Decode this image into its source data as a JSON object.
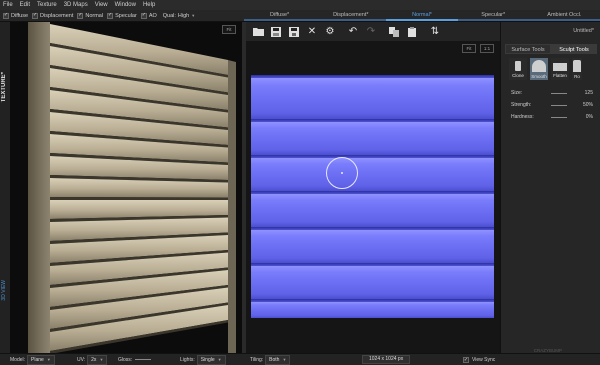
{
  "menu": [
    "File",
    "Edit",
    "Texture",
    "3D Maps",
    "View",
    "Window",
    "Help"
  ],
  "options_bar": {
    "checks": [
      {
        "label": "Diffuse",
        "checked": true
      },
      {
        "label": "Displacement",
        "checked": true
      },
      {
        "label": "Normal",
        "checked": true
      },
      {
        "label": "Specular",
        "checked": true
      },
      {
        "label": "AO",
        "checked": true
      }
    ],
    "quality_label": "Qual:",
    "quality_value": "High"
  },
  "tabs": [
    "Diffuse*",
    "Displacement*",
    "Normal*",
    "Specular*",
    "Ambient Occl."
  ],
  "active_tab": 2,
  "left_strip": {
    "title": "TEXTURE*",
    "link": "3D VIEW"
  },
  "viewport3d": {
    "fit_label": "Fit"
  },
  "toolbar2": {
    "icons": [
      "folder-open-icon",
      "save-icon",
      "save-as-icon",
      "close-icon",
      "gear-icon",
      "undo-icon",
      "redo-icon",
      "copy-icon",
      "paste-icon",
      "swap-icon"
    ]
  },
  "canvas2d": {
    "fit_label": "Fit",
    "ratio_label": "1:1"
  },
  "right_panel": {
    "title": "Untitled*",
    "tabs": [
      "Surface Tools",
      "Sculpt Tools"
    ],
    "active_tab": 1,
    "tools": [
      {
        "label": "Clone",
        "active": false
      },
      {
        "label": "Smooth",
        "active": true
      },
      {
        "label": "Flatten",
        "active": false
      },
      {
        "label": "Ro",
        "active": false
      }
    ],
    "params": [
      {
        "label": "Size:",
        "value": "125"
      },
      {
        "label": "Strength:",
        "value": "50%"
      },
      {
        "label": "Hardness:",
        "value": "0%"
      }
    ]
  },
  "status": {
    "model_label": "Model:",
    "model_value": "Plane",
    "uv_label": "UV:",
    "uv_value": "2x",
    "gloss_label": "Gloss:",
    "lights_label": "Lights:",
    "lights_value": "Single",
    "tiling_label": "Tiling:",
    "tiling_value": "Both",
    "resolution": "1024 x 1024 px",
    "view_sync_label": "View Sync",
    "view_sync_checked": true
  },
  "watermark": "CRAZYBUMP"
}
